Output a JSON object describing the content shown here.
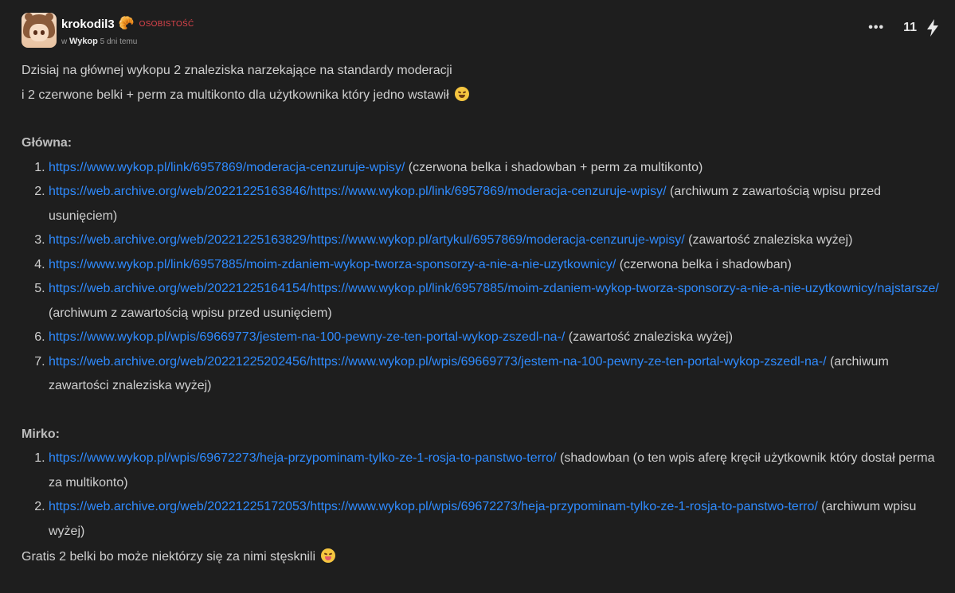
{
  "post": {
    "username": "krokodil3",
    "badge_icon": "croissant-icon",
    "tag": "OSOBISTOŚĆ",
    "community_prefix": "w",
    "community": "Wykop",
    "time": "5 dni temu",
    "more_label": "•••",
    "votes": "11",
    "vote_icon": "lightning-icon"
  },
  "body": {
    "intro_line1": "Dzisiaj na głównej wykopu 2 znaleziska narzekające na standardy moderacji",
    "intro_line2": "i 2 czerwone belki + perm za multikonto dla użytkownika który jedno wstawił",
    "glowna_heading": "Główna:",
    "glowna_items": [
      {
        "url": "https://www.wykop.pl/link/6957869/moderacja-cenzuruje-wpisy/",
        "note": " (czerwona belka i shadowban + perm za multikonto)"
      },
      {
        "url": "https://web.archive.org/web/20221225163846/https://www.wykop.pl/link/6957869/moderacja-cenzuruje-wpisy/",
        "note": " (archiwum z zawartością wpisu przed usunięciem)"
      },
      {
        "url": "https://web.archive.org/web/20221225163829/https://www.wykop.pl/artykul/6957869/moderacja-cenzuruje-wpisy/",
        "note": " (zawartość znaleziska wyżej)"
      },
      {
        "url": "https://www.wykop.pl/link/6957885/moim-zdaniem-wykop-tworza-sponsorzy-a-nie-a-nie-uzytkownicy/",
        "note": " (czerwona belka i shadowban)"
      },
      {
        "url": "https://web.archive.org/web/20221225164154/https://www.wykop.pl/link/6957885/moim-zdaniem-wykop-tworza-sponsorzy-a-nie-a-nie-uzytkownicy/najstarsze/",
        "note": " (archiwum z zawartością wpisu przed usunięciem)"
      },
      {
        "url": "https://www.wykop.pl/wpis/69669773/jestem-na-100-pewny-ze-ten-portal-wykop-zszedl-na-/",
        "note": " (zawartość znaleziska wyżej)"
      },
      {
        "url": "https://web.archive.org/web/20221225202456/https://www.wykop.pl/wpis/69669773/jestem-na-100-pewny-ze-ten-portal-wykop-zszedl-na-/",
        "note": " (archiwum zawartości znaleziska wyżej)"
      }
    ],
    "mirko_heading": "Mirko:",
    "mirko_items": [
      {
        "url": "https://www.wykop.pl/wpis/69672273/heja-przypominam-tylko-ze-1-rosja-to-panstwo-terro/",
        "note": " (shadowban (o ten wpis aferę kręcił użytkownik który dostał perma za multikonto)"
      },
      {
        "url": "https://web.archive.org/web/20221225172053/https://www.wykop.pl/wpis/69672273/heja-przypominam-tylko-ze-1-rosja-to-panstwo-terro/",
        "note": " (archiwum wpisu wyżej)"
      }
    ],
    "outro": "Gratis 2 belki bo może niektórzy się za nimi stęsknili"
  }
}
